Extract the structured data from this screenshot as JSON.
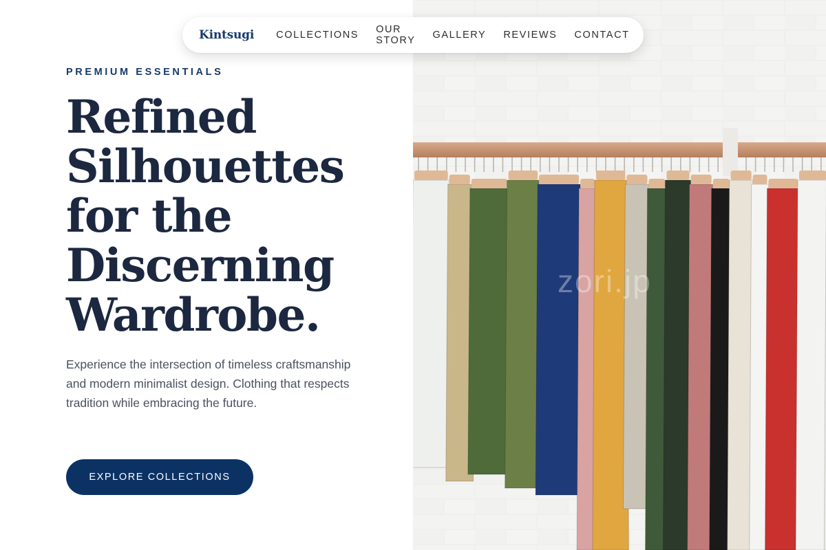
{
  "nav": {
    "brand": "Kintsugi",
    "links": [
      "COLLECTIONS",
      "OUR STORY",
      "GALLERY",
      "REVIEWS",
      "CONTACT"
    ]
  },
  "hero": {
    "eyebrow": "PREMIUM ESSENTIALS",
    "headline_lines": [
      "Refined",
      "Silhouettes",
      "for the",
      "Discerning",
      "Wardrobe."
    ],
    "lede": "Experience the intersection of timeless craftsmanship and modern minimalist design. Clothing that respects tradition while embracing the future.",
    "cta_label": "EXPLORE COLLECTIONS",
    "image_watermark": "zori.jp"
  },
  "colors": {
    "brand_navy": "#0c3264",
    "headline": "#1c2840",
    "body_text": "#4a5160"
  },
  "image": {
    "subject": "clothing-rack-photo",
    "garment_colors": [
      "#eef0ee",
      "#c9b78a",
      "#4f6b3a",
      "#6c7f47",
      "#1f3a78",
      "#d9a3a2",
      "#e0a640",
      "#c9c3b5",
      "#3f5a3a",
      "#2b3a2a",
      "#c07a7a",
      "#1a1a1a",
      "#e9e2d6",
      "#f4f4f2",
      "#c8312e",
      "#f3f3f1",
      "#ebebe8",
      "#222428",
      "#3f6a52",
      "#b85a5a"
    ]
  }
}
